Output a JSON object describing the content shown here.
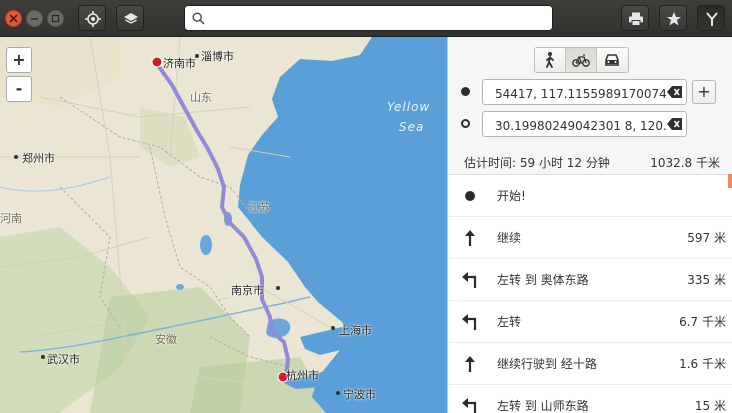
{
  "window": {
    "controls": [
      "close",
      "minimize",
      "maximize"
    ]
  },
  "header": {
    "search": {
      "value": "",
      "placeholder": ""
    },
    "left_buttons": [
      "locate-icon",
      "layers-icon"
    ],
    "right_buttons": [
      "print-icon",
      "star-icon",
      "route-icon"
    ]
  },
  "colors": {
    "route": "#8f8bd9",
    "marker": "#cc1f24",
    "water": "#5b9fd8",
    "land": "#ece7d6",
    "accent": "#f08b54"
  },
  "map": {
    "zoom_in": "+",
    "zoom_out": "-",
    "labels": {
      "jinan": "济南市",
      "zibo": "淄博市",
      "shandong": "山东",
      "zhengzhou": "郑州市",
      "henan": "河南",
      "jiangsu": "江苏",
      "nanjing": "南京市",
      "shanghai": "上海市",
      "anhui": "安徽",
      "wuhan": "武汉市",
      "hangzhou": "杭州市",
      "ningbo": "宁波市",
      "yellow_sea_1": "Yellow",
      "yellow_sea_2": "Sea"
    }
  },
  "sidebar": {
    "transport_modes": [
      {
        "icon": "pedestrian-icon",
        "selected": false
      },
      {
        "icon": "bicycle-icon",
        "selected": true
      },
      {
        "icon": "car-icon",
        "selected": false
      }
    ],
    "origin": "54417, 117.11559891700745",
    "destination": "30.19980249042301 8, 120.18",
    "add_label": "+",
    "summary": {
      "time": "估计时间: 59 小时 12 分钟",
      "distance": "1032.8 千米"
    },
    "instructions": [
      {
        "icon": "start-icon",
        "text": "开始!",
        "distance": ""
      },
      {
        "icon": "straight-icon",
        "text": "继续",
        "distance": "597 米"
      },
      {
        "icon": "turn-left-icon",
        "text": "左转 到 奥体东路",
        "distance": "335 米"
      },
      {
        "icon": "turn-left-icon",
        "text": "左转",
        "distance": "6.7 千米"
      },
      {
        "icon": "straight-icon",
        "text": "继续行驶到 经十路",
        "distance": "1.6 千米"
      },
      {
        "icon": "turn-left-icon",
        "text": "左转 到 山师东路",
        "distance": "15 米"
      }
    ]
  }
}
